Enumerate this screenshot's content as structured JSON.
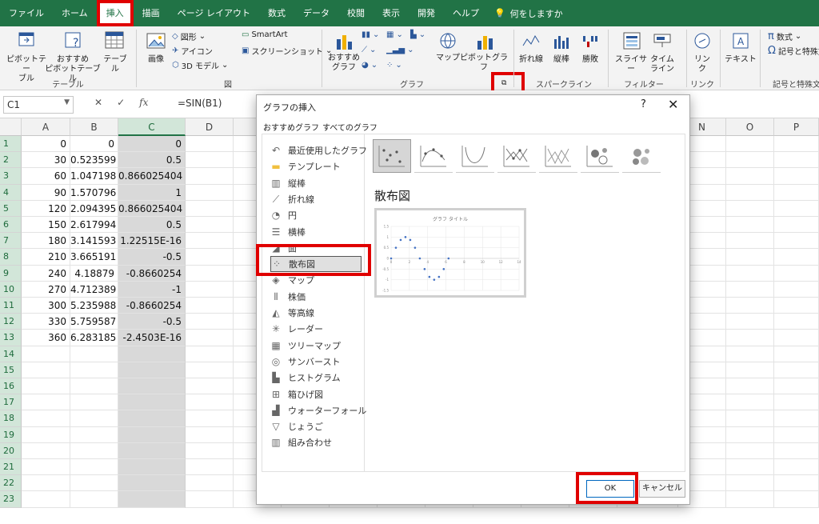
{
  "menu": {
    "tabs": [
      "ファイル",
      "ホーム",
      "挿入",
      "描画",
      "ページ レイアウト",
      "数式",
      "データ",
      "校閲",
      "表示",
      "開発",
      "ヘルプ"
    ],
    "active_tab": "挿入",
    "search_label": "何をしますか"
  },
  "ribbon": {
    "pivot_table": "ピボットテー\nブル",
    "recommended_pivot": "おすすめ\nピボットテーブル",
    "table": "テーブル",
    "group_table": "テーブル",
    "image": "画像",
    "shapes": "図形",
    "icons": "アイコン",
    "models3d": "3D モデル",
    "smartart": "SmartArt",
    "screenshot": "スクリーンショット",
    "group_illust": "図",
    "recommended_charts": "おすすめ\nグラフ",
    "map": "マップ",
    "pivot_chart": "ピボットグラフ",
    "group_chart": "グラフ",
    "line": "折れ線",
    "column": "縦棒",
    "winloss": "勝敗",
    "group_spark": "スパークライン",
    "slicer": "スライサー",
    "timeline": "タイム\nライン",
    "group_filter": "フィルター",
    "link": "リン\nク",
    "group_link": "リンク",
    "textbox": "テキスト",
    "equation": "数式",
    "symbol": "記号と特殊文",
    "group_symbols": "記号と特殊文"
  },
  "formula": {
    "namebox": "C1",
    "fx": "fx",
    "formula": "=SIN(B1)"
  },
  "sheet": {
    "columns": [
      "A",
      "B",
      "C",
      "D",
      "",
      "",
      "",
      "",
      "",
      "",
      "",
      "",
      "",
      "N",
      "O",
      "P"
    ],
    "rows": [
      [
        "0",
        "0",
        "0"
      ],
      [
        "30",
        "0.523599",
        "0.5"
      ],
      [
        "60",
        "1.047198",
        "0.866025404"
      ],
      [
        "90",
        "1.570796",
        "1"
      ],
      [
        "120",
        "2.094395",
        "0.866025404"
      ],
      [
        "150",
        "2.617994",
        "0.5"
      ],
      [
        "180",
        "3.141593",
        "1.22515E-16"
      ],
      [
        "210",
        "3.665191",
        "-0.5"
      ],
      [
        "240",
        "4.18879",
        "-0.8660254"
      ],
      [
        "270",
        "4.712389",
        "-1"
      ],
      [
        "300",
        "5.235988",
        "-0.8660254"
      ],
      [
        "330",
        "5.759587",
        "-0.5"
      ],
      [
        "360",
        "6.283185",
        "-2.4503E-16"
      ],
      [
        "",
        "",
        ""
      ],
      [
        "",
        "",
        ""
      ],
      [
        "",
        "",
        ""
      ],
      [
        "",
        "",
        ""
      ],
      [
        "",
        "",
        ""
      ],
      [
        "",
        "",
        ""
      ],
      [
        "",
        "",
        ""
      ],
      [
        "",
        "",
        ""
      ],
      [
        "",
        "",
        ""
      ],
      [
        "",
        "",
        ""
      ]
    ],
    "row_numbers": [
      "1",
      "2",
      "3",
      "4",
      "5",
      "6",
      "7",
      "8",
      "9",
      "10",
      "11",
      "12",
      "13",
      "14",
      "15",
      "16",
      "17",
      "18",
      "19",
      "20",
      "21",
      "22",
      "23"
    ]
  },
  "dialog": {
    "title": "グラフの挿入",
    "help": "?",
    "close": "✕",
    "tab_recommended": "おすすめグラフ",
    "tab_all": "すべてのグラフ",
    "chart_types": [
      {
        "label": "最近使用したグラフ",
        "icon": "recent-icon"
      },
      {
        "label": "テンプレート",
        "icon": "folder-icon"
      },
      {
        "label": "縦棒",
        "icon": "column-chart-icon"
      },
      {
        "label": "折れ線",
        "icon": "line-chart-icon"
      },
      {
        "label": "円",
        "icon": "pie-chart-icon"
      },
      {
        "label": "横棒",
        "icon": "bar-chart-icon"
      },
      {
        "label": "面",
        "icon": "area-chart-icon"
      },
      {
        "label": "散布図",
        "icon": "scatter-chart-icon"
      },
      {
        "label": "マップ",
        "icon": "map-chart-icon"
      },
      {
        "label": "株価",
        "icon": "stock-chart-icon"
      },
      {
        "label": "等高線",
        "icon": "surface-chart-icon"
      },
      {
        "label": "レーダー",
        "icon": "radar-chart-icon"
      },
      {
        "label": "ツリーマップ",
        "icon": "treemap-icon"
      },
      {
        "label": "サンバースト",
        "icon": "sunburst-icon"
      },
      {
        "label": "ヒストグラム",
        "icon": "histogram-icon"
      },
      {
        "label": "箱ひげ図",
        "icon": "boxplot-icon"
      },
      {
        "label": "ウォーターフォール",
        "icon": "waterfall-icon"
      },
      {
        "label": "じょうご",
        "icon": "funnel-icon"
      },
      {
        "label": "組み合わせ",
        "icon": "combo-chart-icon"
      }
    ],
    "selected_type": "散布図",
    "section_title": "散布図",
    "preview_title": "グラフ タイトル",
    "ok": "OK",
    "cancel": "キャンセル"
  },
  "chart_data": {
    "type": "scatter",
    "title": "グラフ タイトル",
    "x": [
      0,
      0.523599,
      1.047198,
      1.570796,
      2.094395,
      2.617994,
      3.141593,
      3.665191,
      4.18879,
      4.712389,
      5.235988,
      5.759587,
      6.283185
    ],
    "y": [
      0,
      0.5,
      0.866025404,
      1,
      0.866025404,
      0.5,
      0,
      -0.5,
      -0.8660254,
      -1,
      -0.8660254,
      -0.5,
      0
    ],
    "xlim": [
      0,
      14
    ],
    "ylim": [
      -1.5,
      1.5
    ],
    "x_ticks": [
      "0",
      "2",
      "4",
      "6",
      "8",
      "10",
      "12",
      "14"
    ],
    "y_ticks": [
      "1.5",
      "1",
      "0.5",
      "0",
      "-0.5",
      "-1",
      "-1.5"
    ],
    "grid": true,
    "colors": {
      "marker": "#4472c4"
    }
  }
}
